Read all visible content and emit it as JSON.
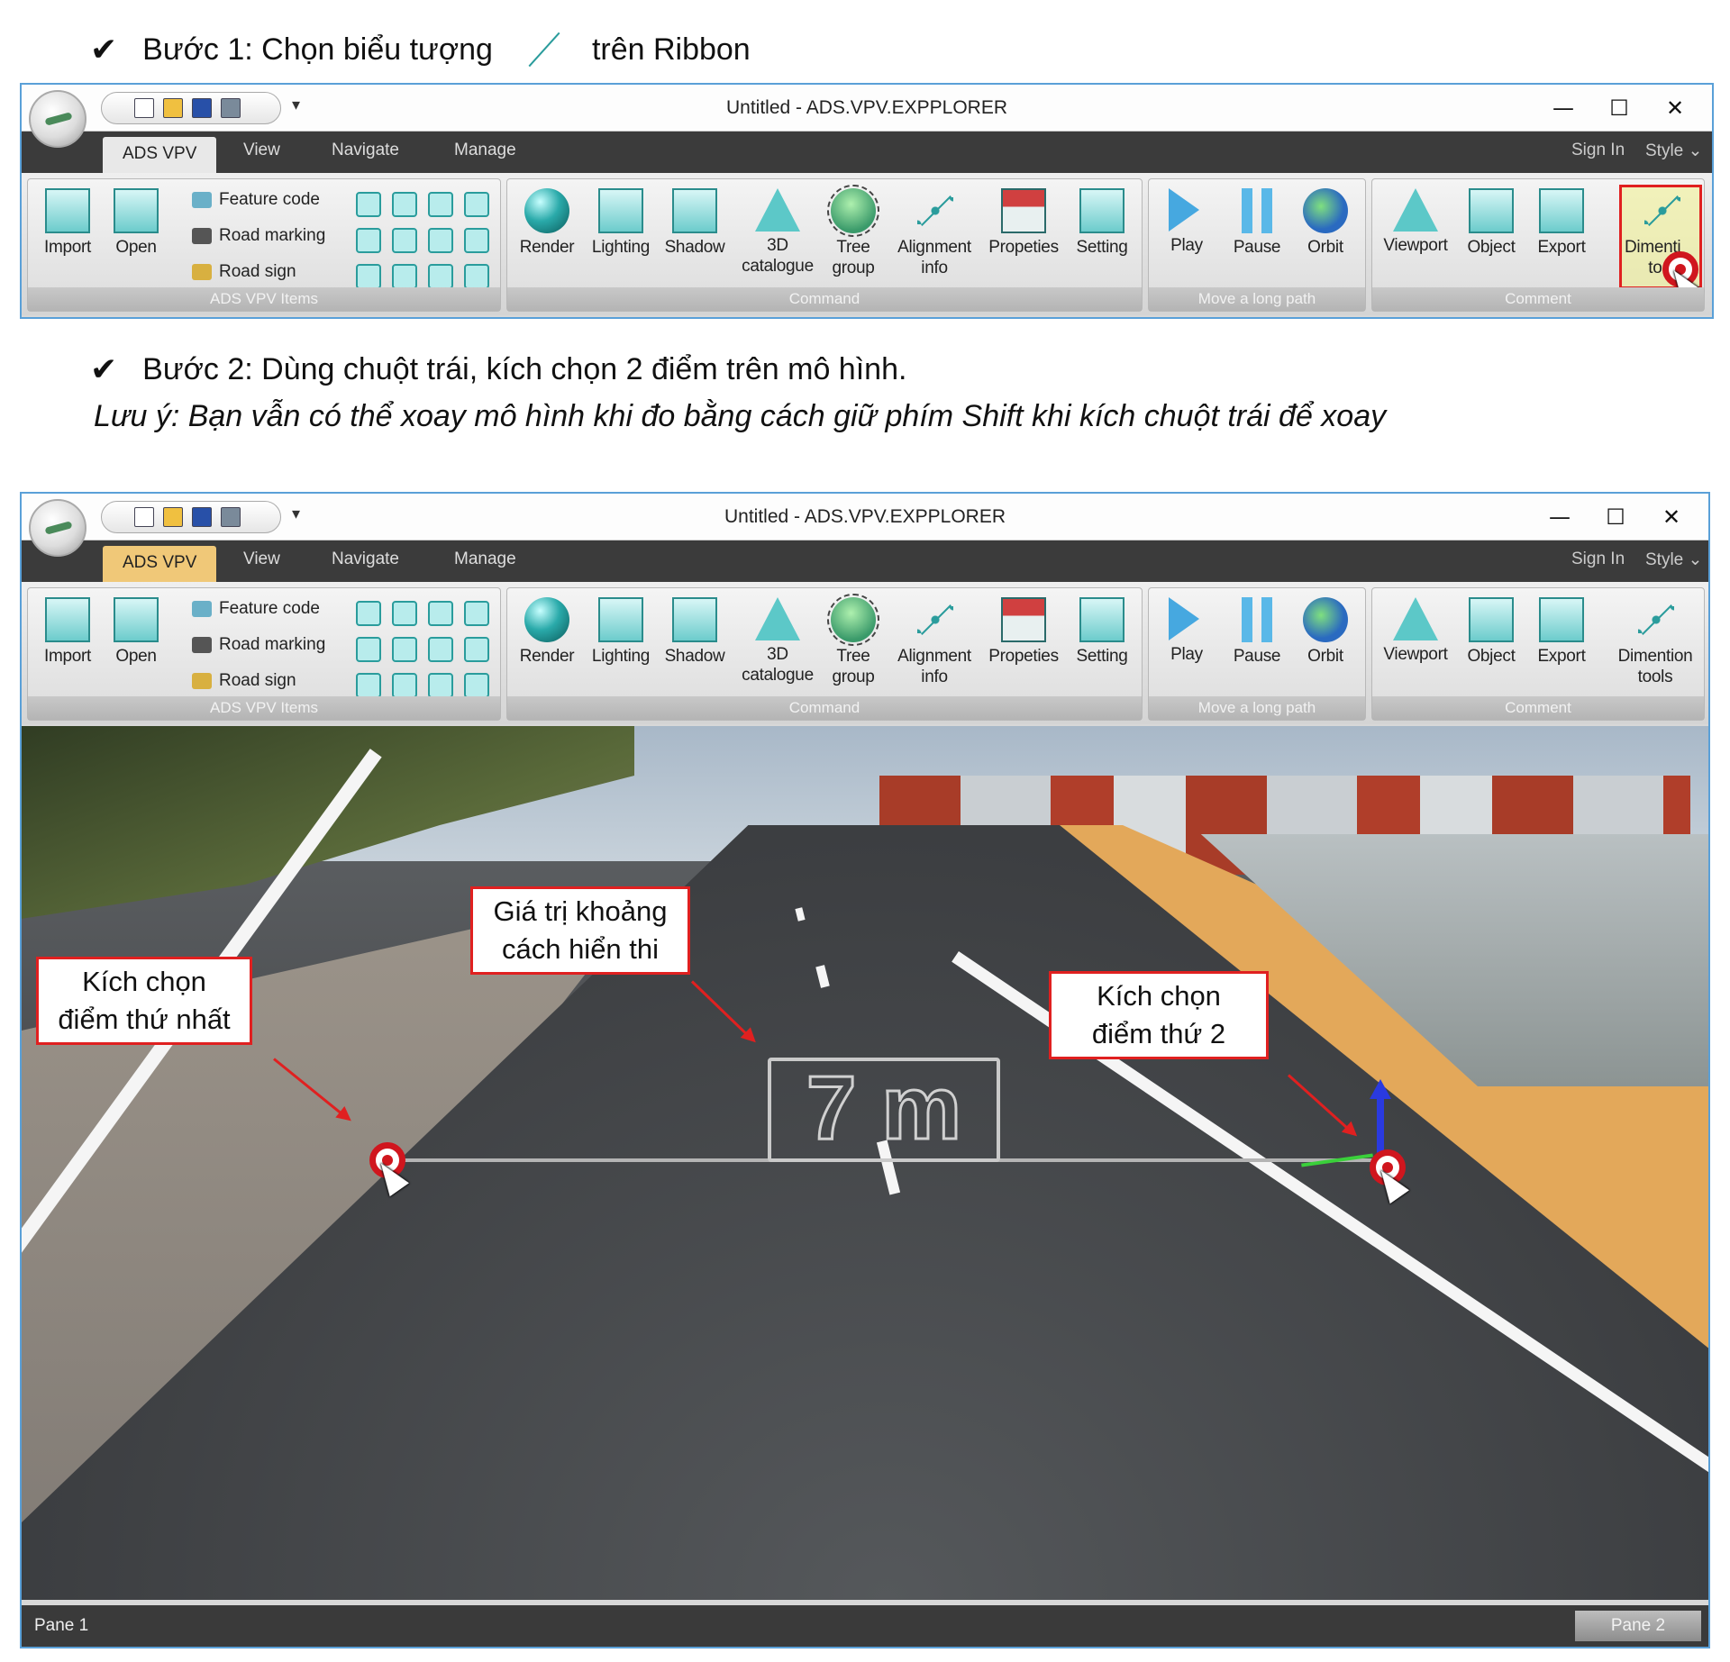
{
  "step1": {
    "check": "✔",
    "before": "Bước 1: Chọn biểu tượng",
    "after": "trên Ribbon"
  },
  "step2": {
    "check": "✔",
    "text": "Bước 2: Dùng chuột trái, kích chọn 2 điểm trên mô hình."
  },
  "note": "Lưu ý: Bạn vẫn có thể xoay mô hình khi đo bằng cách giữ phím Shift khi kích chuột trái để xoay",
  "window": {
    "title": "Untitled - ADS.VPV.EXPPLORER",
    "controls": {
      "minimize": "—",
      "maximize": "☐",
      "close": "✕"
    },
    "qat_dropdown": "▾",
    "tabs": [
      "ADS VPV",
      "View",
      "Navigate",
      "Manage"
    ],
    "right_tabs": {
      "sign_in": "Sign In",
      "style": "Style ⌄"
    },
    "groups": {
      "items": "ADS VPV Items",
      "command": "Command",
      "path": "Move a long path",
      "comment": "Comment"
    },
    "buttons": {
      "import": "Import",
      "open": "Open",
      "feature_code": "Feature code",
      "road_marking": "Road marking",
      "road_sign": "Road sign",
      "render": "Render",
      "lighting": "Lighting",
      "shadow": "Shadow",
      "catalogue_1": "3D",
      "catalogue_2": "catalogue",
      "tree_1": "Tree",
      "tree_2": "group",
      "align_1": "Alignment",
      "align_2": "info",
      "propeties": "Propeties",
      "setting": "Setting",
      "play": "Play",
      "pause": "Pause",
      "orbit": "Orbit",
      "viewport": "Viewport",
      "object": "Object",
      "export": "Export",
      "dim_1": "Dimention",
      "dim_2": "tools",
      "dim_1_cut": "Dimenti",
      "dim_2_cut": "tool"
    },
    "icons": [
      "new-icon",
      "open-folder-icon",
      "save-icon",
      "print-icon",
      "import-icon",
      "folder-icon",
      "render-sphere-icon",
      "lighting-icon",
      "shadow-icon",
      "catalogue-icon",
      "tree-icon",
      "alignment-icon",
      "house-icon",
      "tools-icon",
      "play-icon",
      "pause-icon",
      "orbit-icon",
      "viewport-icon",
      "object-icon",
      "export-icon",
      "dimension-icon"
    ],
    "status": {
      "pane1": "Pane 1",
      "pane2": "Pane 2"
    }
  },
  "callouts": {
    "first_1": "Kích chọn",
    "first_2": "điểm thứ nhất",
    "value_1": "Giá trị khoảng",
    "value_2": "cách hiển thi",
    "second_1": "Kích chọn",
    "second_2": "điểm thứ 2"
  },
  "measure_label": "7 m",
  "colors": {
    "highlight": "#e02020",
    "tab_active": "#f0c878",
    "teal": "#2a9c9c"
  }
}
